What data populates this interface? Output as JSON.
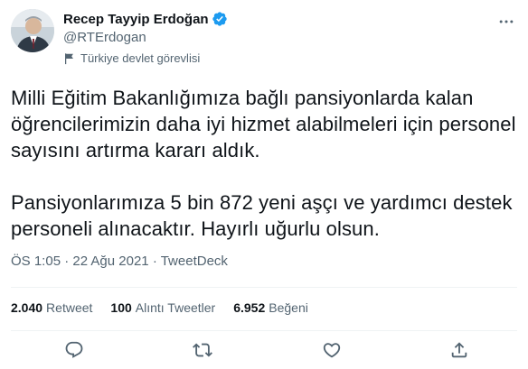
{
  "author": {
    "name": "Recep Tayyip Erdoğan",
    "handle": "@RTErdogan",
    "label": "Türkiye devlet görevlisi"
  },
  "tweet": {
    "paragraph1": "Milli Eğitim Bakanlığımıza bağlı pansiyonlarda kalan öğrencilerimizin daha iyi hizmet alabilmeleri için personel sayısını artırma kararı aldık.",
    "paragraph2": "Pansiyonlarımıza 5 bin 872 yeni aşçı ve yardımcı destek personeli alınacaktır. Hayırlı uğurlu olsun."
  },
  "meta": {
    "time": "ÖS 1:05",
    "separator1": " · ",
    "date": "22 Ağu 2021",
    "separator2": " · ",
    "source": "TweetDeck"
  },
  "stats": {
    "retweets": {
      "count": "2.040",
      "label": "Retweet"
    },
    "quotes": {
      "count": "100",
      "label": "Alıntı Tweetler"
    },
    "likes": {
      "count": "6.952",
      "label": "Beğeni"
    }
  },
  "icons": {
    "verified": "verified-badge-icon",
    "government": "flag-icon",
    "more": "more-icon",
    "reply": "reply-icon",
    "retweet": "retweet-icon",
    "like": "heart-icon",
    "share": "share-icon"
  },
  "colors": {
    "verified": "#1d9bf0",
    "text_primary": "#0f1419",
    "text_secondary": "#536471",
    "divider": "#eff3f4"
  }
}
